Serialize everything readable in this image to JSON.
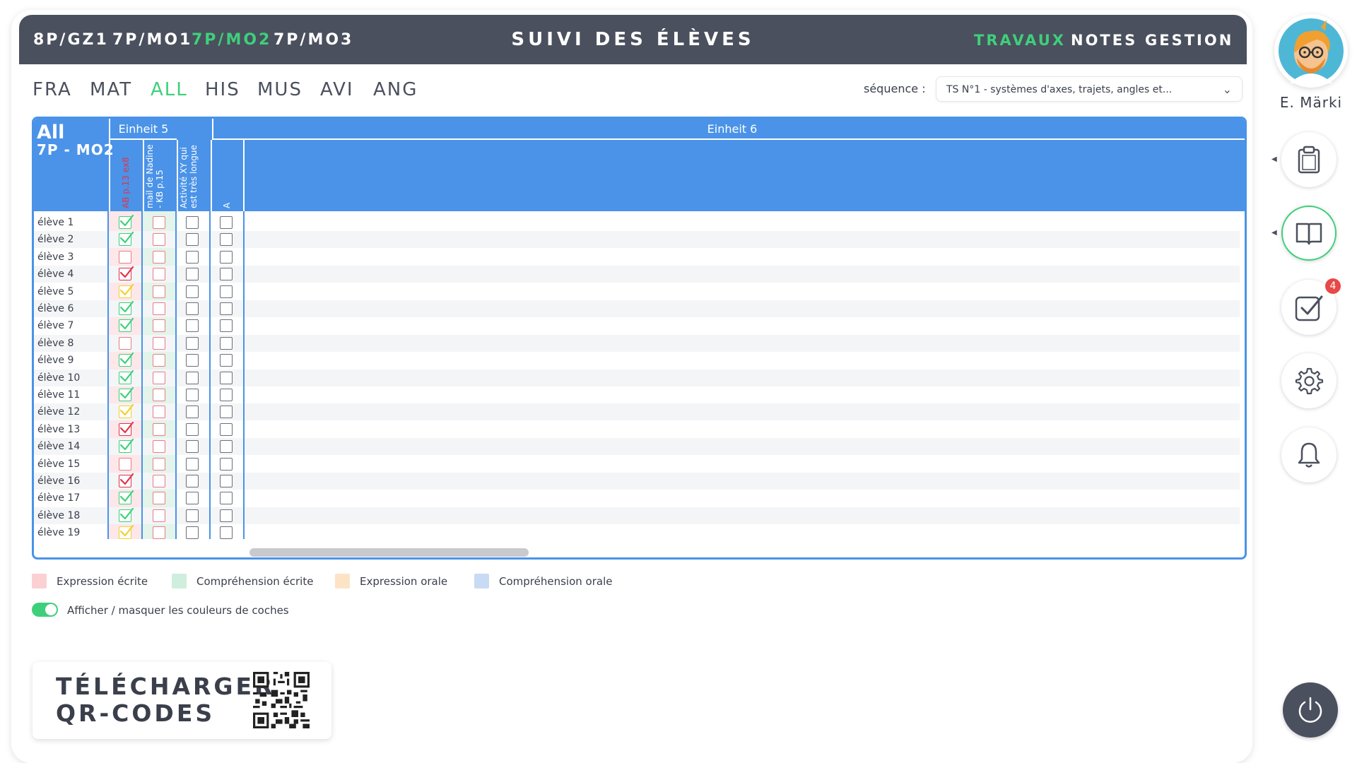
{
  "topbar": {
    "classes": [
      "8P/GZ1",
      "7P/MO1",
      "7P/MO2",
      "7P/MO3"
    ],
    "active_class": 2,
    "title": "SUIVI DES ÉLÈVES",
    "nav": [
      "TRAVAUX",
      "NOTES",
      "GESTION"
    ],
    "active_nav": 0
  },
  "subjects": {
    "items": [
      "FRA",
      "MAT",
      "ALL",
      "HIS",
      "MUS",
      "AVI",
      "ANG"
    ],
    "active": 2
  },
  "sequence": {
    "label": "séquence :",
    "value": "TS N°1 - systèmes d'axes, trajets, angles et..."
  },
  "table": {
    "header_subject": "All",
    "header_class": "7P - MO2",
    "units": [
      "Einheit 5",
      "Einheit 6"
    ],
    "columns": [
      {
        "label": "AB p.13 ex8",
        "color": "#e0334a"
      },
      {
        "label": "mail de Nadine\n- KB p.15",
        "color": "#ffffff"
      },
      {
        "label": "Activité XY qui\nest très longue",
        "color": "#ffffff"
      },
      {
        "label": "A",
        "color": "#ffffff"
      }
    ],
    "students": [
      "élève 1",
      "élève 2",
      "élève 3",
      "élève 4",
      "élève 5",
      "élève 6",
      "élève 7",
      "élève 8",
      "élève 9",
      "élève 10",
      "élève 11",
      "élève 12",
      "élève 13",
      "élève 14",
      "élève 15",
      "élève 16",
      "élève 17",
      "élève 18",
      "élève 19"
    ],
    "col1_status": [
      "green",
      "green",
      "empty",
      "red",
      "yellow",
      "green",
      "green",
      "empty",
      "green",
      "green",
      "green",
      "yellow",
      "red",
      "green",
      "empty",
      "red",
      "green",
      "green",
      "yellow"
    ]
  },
  "legend": [
    {
      "label": "Expression écrite",
      "color": "#fbd0d3"
    },
    {
      "label": "Compréhension écrite",
      "color": "#cfeedd"
    },
    {
      "label": "Expression orale",
      "color": "#fde3c6"
    },
    {
      "label": "Compréhension orale",
      "color": "#c9daf4"
    }
  ],
  "toggle": {
    "label": "Afficher / masquer les couleurs de coches",
    "on": true
  },
  "qr": {
    "line1": "TÉLÉCHARGER",
    "line2": "QR-CODES"
  },
  "user": {
    "name": "E. Märki"
  },
  "rail": {
    "badge_count": "4"
  },
  "colors": {
    "accent_green": "#3ecf7b",
    "header_blue": "#4a93e8",
    "dark": "#4a505d"
  }
}
